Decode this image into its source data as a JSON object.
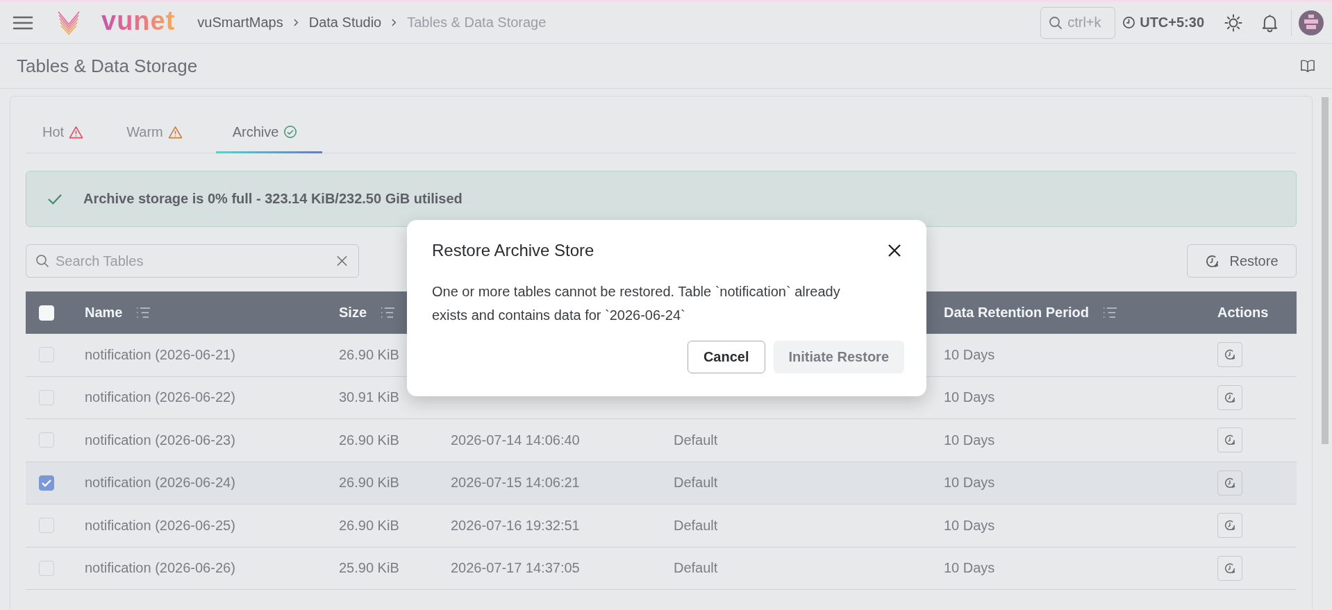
{
  "topbar": {
    "logo_text": "vunet",
    "breadcrumbs": [
      {
        "label": "vuSmartMaps",
        "current": false
      },
      {
        "label": "Data Studio",
        "current": false
      },
      {
        "label": "Tables & Data Storage",
        "current": true
      }
    ],
    "search": {
      "placeholder": "ctrl+k"
    },
    "timezone": "UTC+5:30"
  },
  "page_title": "Tables & Data Storage",
  "tabs": [
    {
      "label": "Hot",
      "kind": "warning",
      "color": "#d9506e",
      "selected": false
    },
    {
      "label": "Warm",
      "kind": "warning",
      "color": "#c98246",
      "selected": false
    },
    {
      "label": "Archive",
      "kind": "ok",
      "color": "#4c9a78",
      "selected": true
    }
  ],
  "alert": {
    "kind": "success",
    "text": "Archive storage is 0% full - 323.14 KiB/232.50 GiB utilised"
  },
  "search": {
    "placeholder": "Search Tables"
  },
  "restore_button": {
    "label": "Restore"
  },
  "table": {
    "all_checked": false,
    "columns": [
      {
        "label": "Name",
        "sortable": true
      },
      {
        "label": "Size",
        "sortable": true
      },
      {},
      {},
      {
        "label": "Data Retention Period",
        "sortable": true
      },
      {
        "label": "Actions",
        "sortable": false
      }
    ],
    "rows": [
      {
        "selected": false,
        "cells": [
          "notification (2026-06-21)",
          "26.90 KiB",
          null,
          null,
          "10 Days"
        ]
      },
      {
        "selected": false,
        "cells": [
          "notification (2026-06-22)",
          "30.91 KiB",
          null,
          null,
          "10 Days"
        ]
      },
      {
        "selected": false,
        "cells": [
          "notification (2026-06-23)",
          "26.90 KiB",
          "2026-07-14 14:06:40",
          "Default",
          "10 Days"
        ]
      },
      {
        "selected": true,
        "cells": [
          "notification (2026-06-24)",
          "26.90 KiB",
          "2026-07-15 14:06:21",
          "Default",
          "10 Days"
        ]
      },
      {
        "selected": false,
        "cells": [
          "notification (2026-06-25)",
          "26.90 KiB",
          "2026-07-16 19:32:51",
          "Default",
          "10 Days"
        ]
      },
      {
        "selected": false,
        "cells": [
          "notification (2026-06-26)",
          "25.90 KiB",
          "2026-07-17 14:37:05",
          "Default",
          "10 Days"
        ]
      }
    ]
  },
  "dialog": {
    "title": "Restore Archive Store",
    "message": "One or more tables cannot be restored. Table `notification` already exists and contains data for `2026-06-24`",
    "buttons": [
      {
        "label": "Cancel",
        "kind": "secondary",
        "disabled": false
      },
      {
        "label": "Initiate Restore",
        "kind": "primary",
        "disabled": true
      }
    ]
  }
}
